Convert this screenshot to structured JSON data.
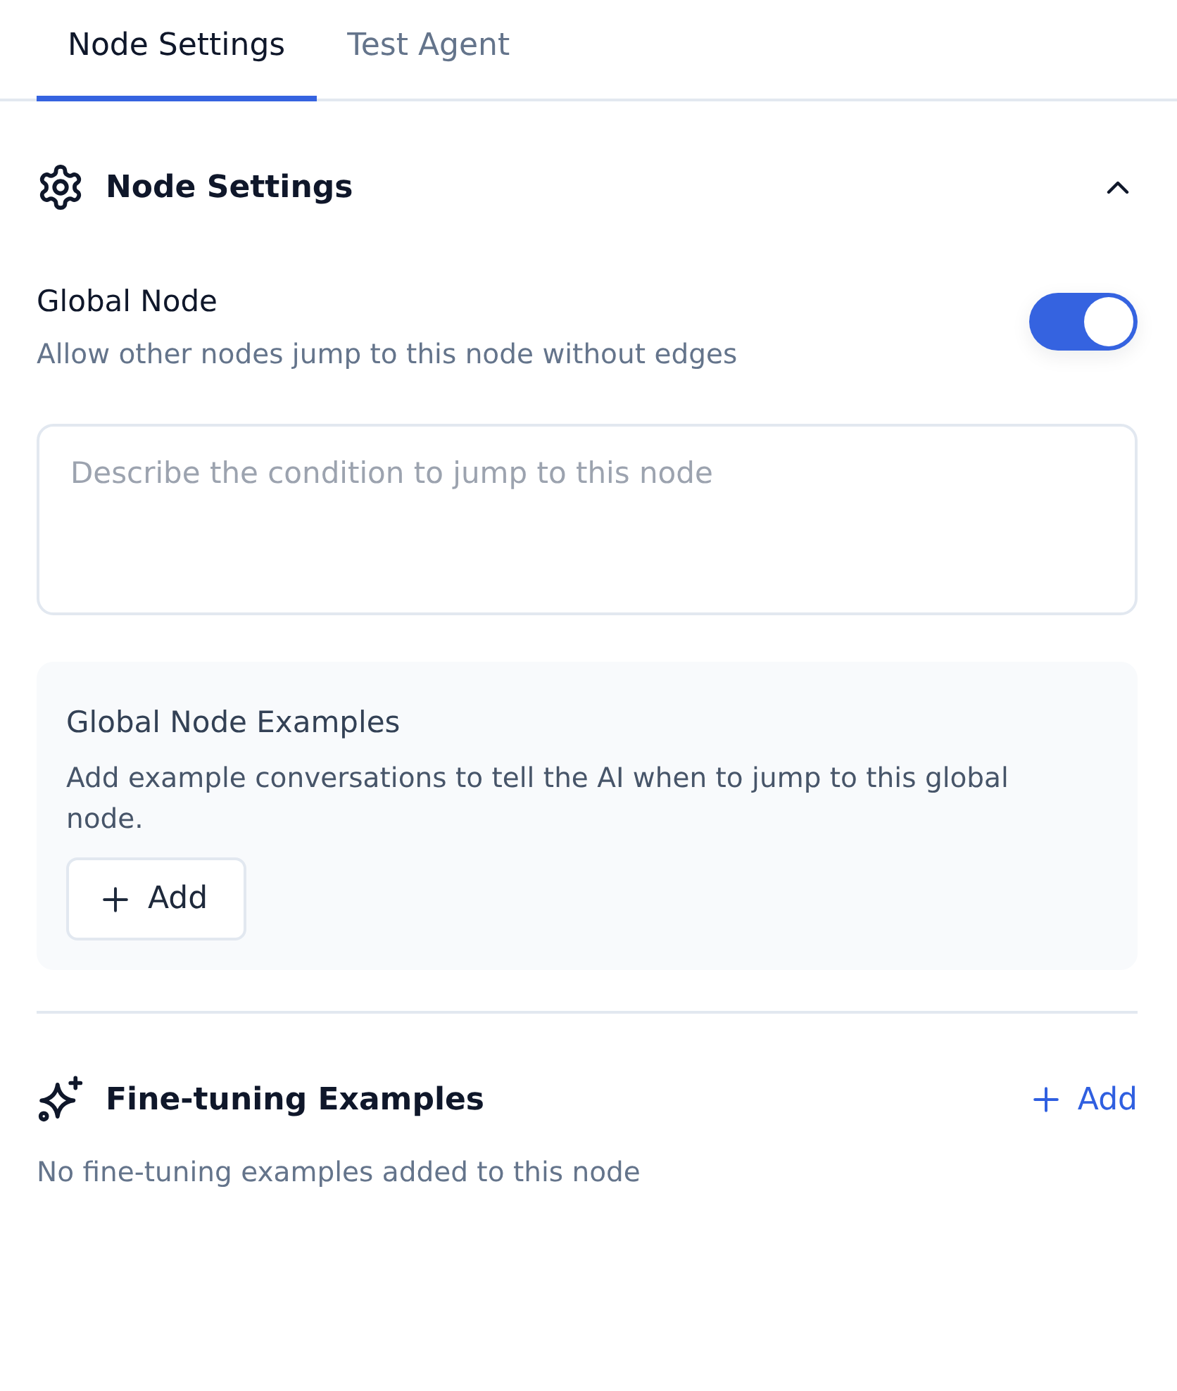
{
  "tabs": [
    {
      "label": "Node Settings",
      "selected": true
    },
    {
      "label": "Test Agent",
      "selected": false
    }
  ],
  "node_settings": {
    "title": "Node Settings",
    "expanded": true,
    "global_node": {
      "label": "Global Node",
      "description": "Allow other nodes jump to this node without edges",
      "on": true
    },
    "condition_field": {
      "placeholder": "Describe the condition to jump to this node"
    },
    "examples": {
      "title": "Global Node Examples",
      "description": "Add example conversations to tell the AI when to jump to this global node.",
      "add_button": "Add"
    }
  },
  "fine_tuning": {
    "title": "Fine-tuning Examples",
    "add_link": "Add",
    "empty_text": "No fine-tuning examples added to this node"
  }
}
